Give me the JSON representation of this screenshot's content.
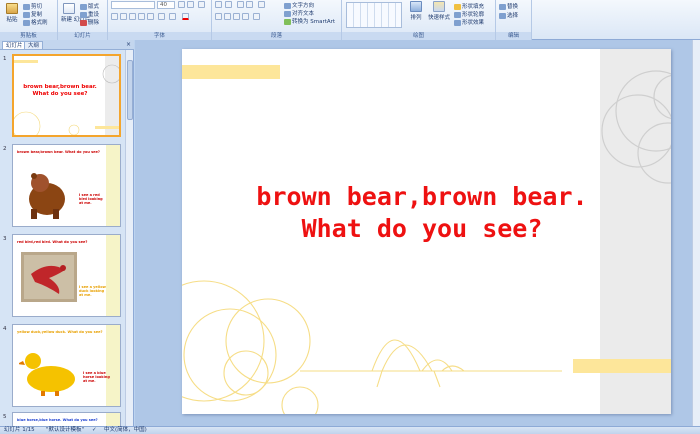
{
  "ribbon": {
    "clipboard": {
      "paste": "粘贴",
      "cut": "剪切",
      "copy": "复制",
      "format_painter": "格式刷",
      "group": "剪贴板"
    },
    "slides": {
      "new_slide": "新建\n幻灯片",
      "layout": "版式",
      "reset": "重设",
      "delete": "删除",
      "group": "幻灯片"
    },
    "font": {
      "font_name": "",
      "font_size": "40",
      "group": "字体"
    },
    "paragraph": {
      "text_direction": "文字方向",
      "align_text": "对齐文本",
      "smartart": "转换为 SmartArt",
      "group": "段落"
    },
    "drawing": {
      "arrange": "排列",
      "quick_styles": "快速样式",
      "shape_fill": "形状填充",
      "shape_outline": "形状轮廓",
      "shape_effects": "形状效果",
      "group": "绘图"
    },
    "editing": {
      "replace": "替换",
      "select": "选择",
      "group": "编辑"
    }
  },
  "pane": {
    "tab_slides": "幻灯片",
    "tab_outline": "大纲",
    "close": "×",
    "thumbs": [
      {
        "num": "1",
        "title": "brown bear,brown bear.\nWhat do you see?"
      },
      {
        "num": "2",
        "title": "brown bear,brown bear. What do you see?",
        "caption": "I see a red bird looking at me."
      },
      {
        "num": "3",
        "title": "red bird,red bird. What do you see?",
        "caption": "I see a yellow duck looking at me."
      },
      {
        "num": "4",
        "title": "yellow duck,yellow duck. What do you see?",
        "caption": "I see a blue horse looking at me."
      },
      {
        "num": "5",
        "title": "blue horse,blue horse. What do you see?"
      }
    ]
  },
  "slide": {
    "title_line1": "brown bear,brown bear.",
    "title_line2": "What do you see?"
  },
  "status": {
    "slide_count": "幻灯片 1/15",
    "theme": "\"默认设计模板\"",
    "language": "中文(简体，中国)"
  },
  "colors": {
    "title_red": "#ee1111",
    "accent_yellow": "#fde69a",
    "ribbon_bg": "#dbe7f6",
    "workspace_bg": "#afc7e7"
  }
}
